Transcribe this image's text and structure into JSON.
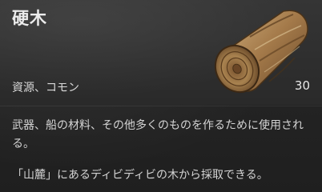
{
  "item": {
    "name": "硬木",
    "subtitle": "資源、コモン",
    "count": "30",
    "icon": "hardwood-log-icon",
    "description": "武器、船の材料、その他多くのものを作るために使用される。",
    "source": "「山麓」にあるディビディビの木から採取できる。"
  },
  "colors": {
    "background": "#232323",
    "title": "#ececec",
    "text": "#d4d4d4",
    "wood_bark": "#a07a4a",
    "wood_ring": "#8a5a30"
  }
}
